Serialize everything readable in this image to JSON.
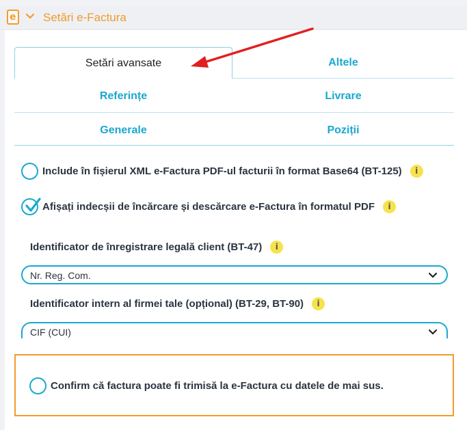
{
  "header": {
    "icon_letter": "e",
    "title": "Setări e-Factura"
  },
  "tabs": [
    {
      "label": "Setări avansate",
      "active": true
    },
    {
      "label": "Altele",
      "active": false
    },
    {
      "label": "Referințe",
      "active": false
    },
    {
      "label": "Livrare",
      "active": false
    },
    {
      "label": "Generale",
      "active": false
    },
    {
      "label": "Poziții",
      "active": false
    }
  ],
  "options": {
    "include_pdf": {
      "label": "Include în fișierul XML e-Factura PDF-ul facturii în format Base64 (BT-125)",
      "checked": false
    },
    "show_indecsii": {
      "label": "Afișați indecșii de încărcare și descărcare e-Factura în formatul PDF",
      "checked": true
    }
  },
  "fields": {
    "legal_id": {
      "label": "Identificator de înregistrare legală client (BT-47)",
      "value": "Nr. Reg. Com."
    },
    "internal_id": {
      "label": "Identificator intern al firmei tale (opțional) (BT-29, BT-90)",
      "value": "CIF (CUI)"
    }
  },
  "confirm": {
    "label": "Confirm că factura poate fi trimisă la e-Factura cu datele de mai sus.",
    "checked": false
  },
  "info_glyph": "i",
  "colors": {
    "accent": "#1aa8d0",
    "orange": "#f39a2b",
    "info": "#f7e24b",
    "arrow": "#e21f1f"
  }
}
